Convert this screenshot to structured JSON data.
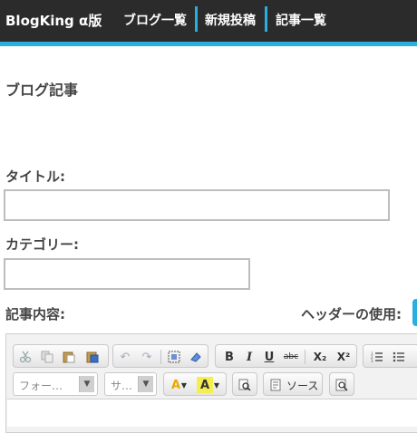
{
  "nav": {
    "brand": "BlogKing α版",
    "items": [
      {
        "label": "ブログ一覧"
      },
      {
        "label": "新規投稿"
      },
      {
        "label": "記事一覧"
      }
    ]
  },
  "page": {
    "title": "ブログ記事"
  },
  "form": {
    "title_label": "タイトル:",
    "title_value": "",
    "category_label": "カテゴリー:",
    "category_value": "",
    "content_label": "記事内容:",
    "header_use_label": "ヘッダーの使用:"
  },
  "editor": {
    "row1_icons": [
      "cut-icon",
      "copy-icon",
      "paste-icon",
      "paste-word-icon",
      "undo-icon",
      "redo-icon",
      "select-all-icon",
      "remove-format-icon",
      "bold-icon",
      "italic-icon",
      "underline-icon",
      "strikethrough-icon",
      "subscript-icon",
      "superscript-icon",
      "numbered-list-icon",
      "bulleted-list-icon"
    ],
    "format_placeholder": "フォー…",
    "size_placeholder": "サ…",
    "source_label": "ソース",
    "bold_glyph": "B",
    "italic_glyph": "I",
    "underline_glyph": "U",
    "strike_glyph": "abc",
    "sub_glyph": "X₂",
    "sup_glyph": "X²",
    "text_color_glyph": "A",
    "bg_color_glyph": "A"
  },
  "colors": {
    "accent": "#29aee0",
    "nav_bg": "#2b2b2b"
  }
}
